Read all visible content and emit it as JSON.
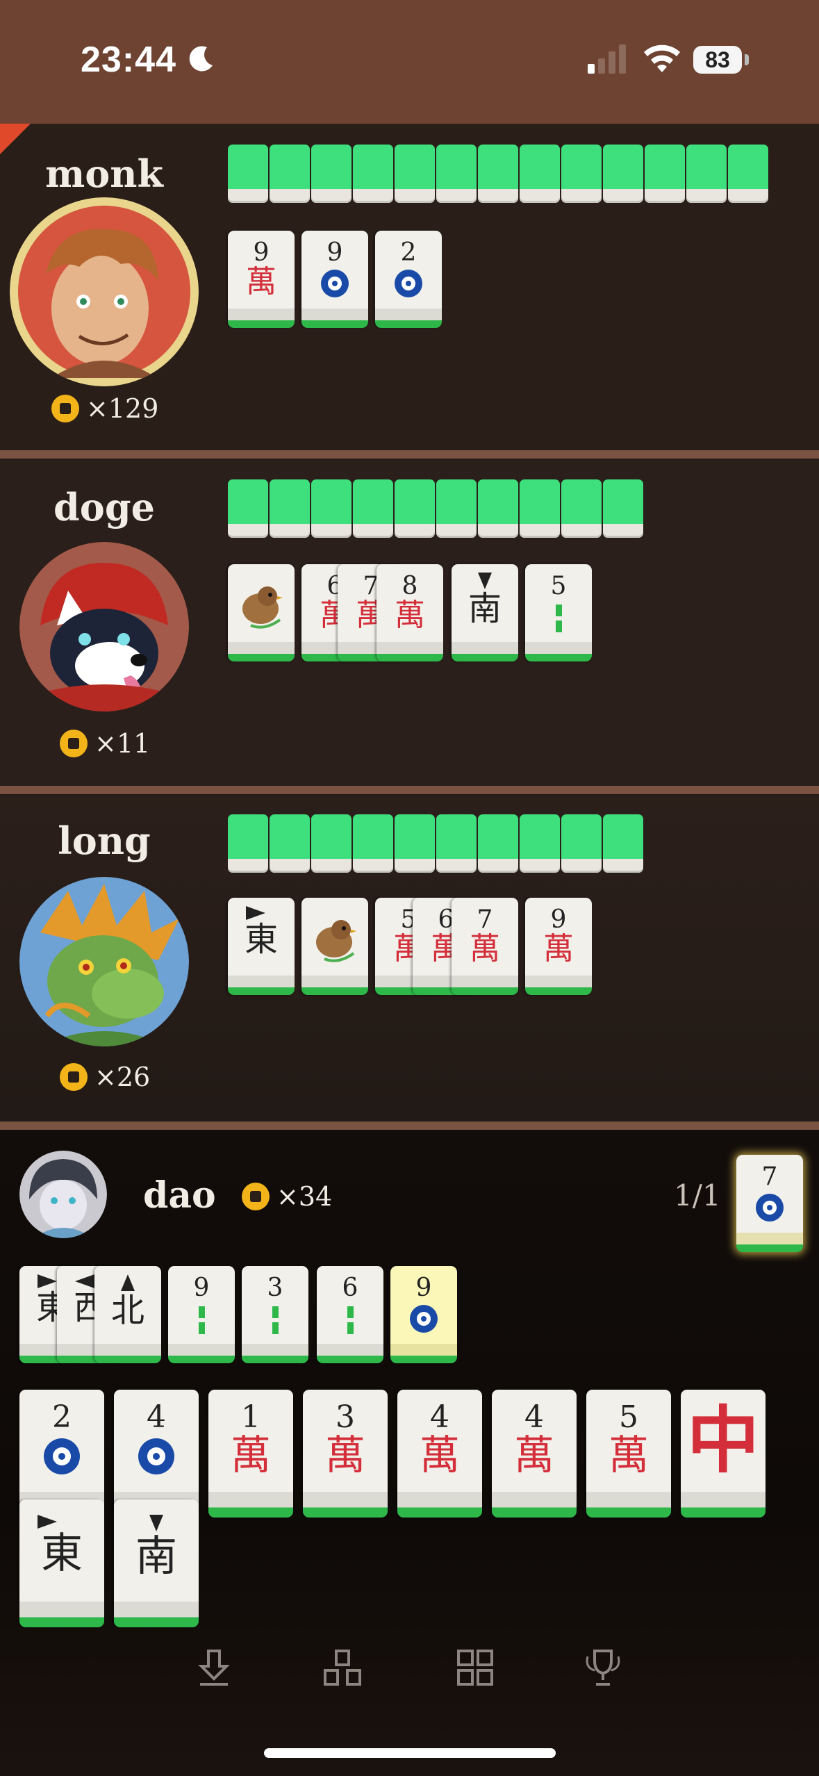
{
  "status_bar": {
    "time": "23:44",
    "battery": "83"
  },
  "players": [
    {
      "name": "monk",
      "coins": "×129",
      "revealed": [
        {
          "rank": "9",
          "suit": "wan",
          "glyph": "萬"
        },
        {
          "rank": "9",
          "suit": "dot"
        },
        {
          "rank": "2",
          "suit": "dot"
        }
      ]
    },
    {
      "name": "doge",
      "coins": "×11",
      "revealed": [
        {
          "suit": "bird"
        },
        {
          "rank": "6",
          "suit": "wan",
          "glyph": "萬"
        },
        {
          "rank": "7",
          "suit": "wan",
          "glyph": "萬"
        },
        {
          "rank": "8",
          "suit": "wan",
          "glyph": "萬"
        },
        {
          "suit": "wind",
          "glyph": "南"
        },
        {
          "rank": "5",
          "suit": "bamboo"
        }
      ]
    },
    {
      "name": "long",
      "coins": "×26",
      "revealed": [
        {
          "suit": "wind",
          "glyph": "東"
        },
        {
          "suit": "bird"
        },
        {
          "rank": "5",
          "suit": "wan",
          "glyph": "萬"
        },
        {
          "rank": "6",
          "suit": "wan",
          "glyph": "萬"
        },
        {
          "rank": "7",
          "suit": "wan",
          "glyph": "萬"
        },
        {
          "rank": "9",
          "suit": "wan",
          "glyph": "萬"
        }
      ]
    }
  ],
  "me": {
    "name": "dao",
    "coins": "×34",
    "counter": "1/1",
    "drawn_tile": {
      "rank": "7",
      "suit": "dot"
    },
    "melds": [
      {
        "suit": "wind",
        "glyph": "東"
      },
      {
        "suit": "wind",
        "glyph": "西"
      },
      {
        "suit": "wind",
        "glyph": "北"
      },
      {
        "rank": "9",
        "suit": "bamboo"
      },
      {
        "rank": "3",
        "suit": "bamboo"
      },
      {
        "rank": "6",
        "suit": "bamboo"
      },
      {
        "rank": "9",
        "suit": "dot",
        "highlighted": true
      }
    ],
    "hand_row1": [
      {
        "rank": "2",
        "suit": "dot"
      },
      {
        "rank": "4",
        "suit": "dot"
      },
      {
        "rank": "1",
        "suit": "wan",
        "glyph": "萬"
      },
      {
        "rank": "3",
        "suit": "wan",
        "glyph": "萬"
      },
      {
        "rank": "4",
        "suit": "wan",
        "glyph": "萬"
      },
      {
        "rank": "4",
        "suit": "wan",
        "glyph": "萬"
      },
      {
        "rank": "5",
        "suit": "wan",
        "glyph": "萬"
      },
      {
        "suit": "dragon",
        "glyph": "中"
      }
    ],
    "hand_row2": [
      {
        "suit": "wind",
        "glyph": "東"
      },
      {
        "suit": "wind",
        "glyph": "南"
      }
    ]
  },
  "toolbar": [
    "download-icon",
    "tiles-icon",
    "grid-icon",
    "trophy-icon"
  ],
  "colors": {
    "tile_back": "#3ee07e",
    "wan_red": "#d42e3a",
    "dot_blue": "#1a4aa8",
    "coin": "#f3b41a"
  }
}
